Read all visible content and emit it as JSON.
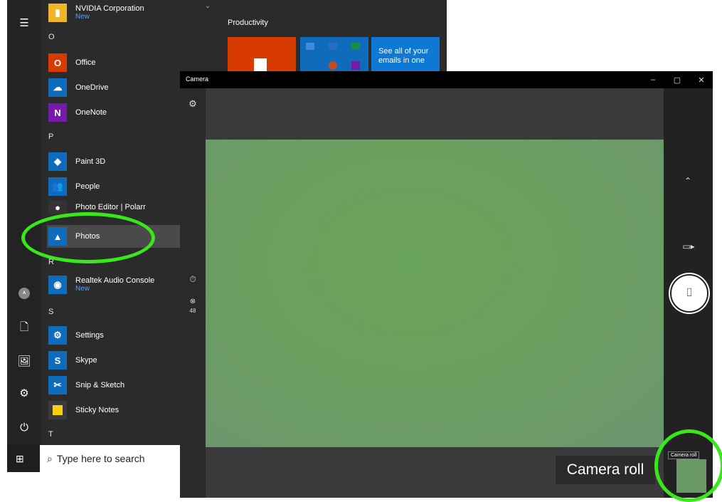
{
  "start_menu": {
    "letters": [
      "O",
      "P",
      "R",
      "S",
      "T"
    ],
    "apps": [
      {
        "label": "NVIDIA Corporation",
        "sub": "New",
        "color": "#f0b428"
      },
      {
        "label": "Office",
        "sub": "",
        "color": "#d83b01"
      },
      {
        "label": "OneDrive",
        "sub": "",
        "color": "#0f6cbd"
      },
      {
        "label": "OneNote",
        "sub": "",
        "color": "#7719aa"
      },
      {
        "label": "Paint 3D",
        "sub": "",
        "color": "#0f6cbd"
      },
      {
        "label": "People",
        "sub": "",
        "color": "#0f6cbd"
      },
      {
        "label": "Photo Editor | Polarr",
        "sub": "",
        "color": "#333333"
      },
      {
        "label": "Photos",
        "sub": "",
        "color": "#0f6cbd"
      },
      {
        "label": "Realtek Audio Console",
        "sub": "New",
        "color": "#0f6cbd"
      },
      {
        "label": "Settings",
        "sub": "",
        "color": "#0f6cbd"
      },
      {
        "label": "Skype",
        "sub": "",
        "color": "#0f6cbd"
      },
      {
        "label": "Snip & Sketch",
        "sub": "",
        "color": "#0f6cbd"
      },
      {
        "label": "Sticky Notes",
        "sub": "",
        "color": "#3a3a3a"
      }
    ],
    "tiles_header": "Productivity",
    "mail_tile_text": "See all of your emails in one",
    "search_placeholder": "Type here to search"
  },
  "camera": {
    "title": "Camera",
    "timer_badge": "48",
    "camera_roll_label": "Camera roll",
    "camera_roll_tooltip": "Camera roll"
  }
}
